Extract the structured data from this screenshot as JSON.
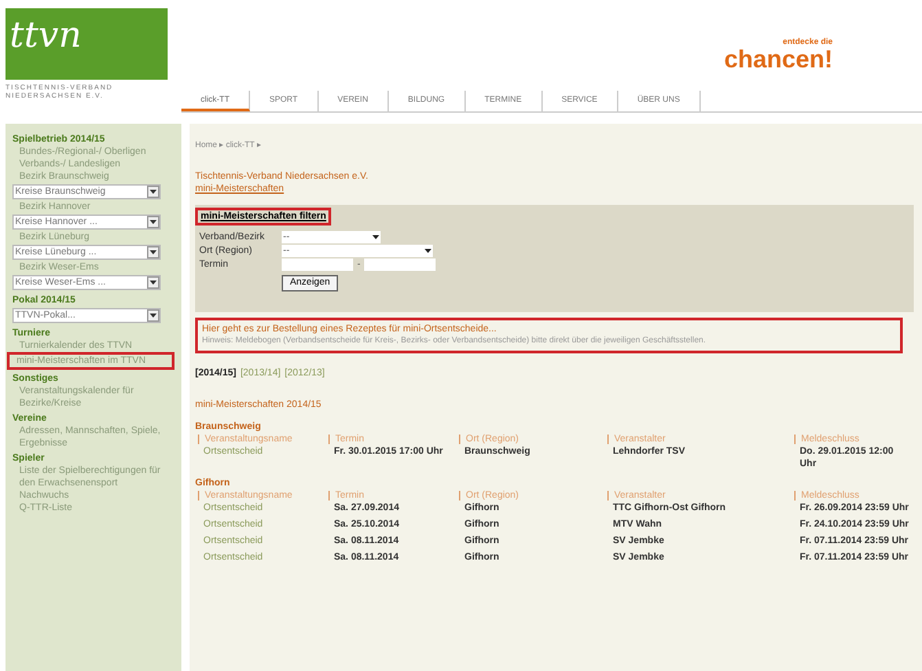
{
  "header": {
    "logo_text": "ttvn",
    "association": "TISCHTENNIS-VERBAND NIEDERSACHSEN E.V.",
    "slogan_top": "entdecke die",
    "slogan": "chancen!"
  },
  "tabs": [
    {
      "label": "click-TT",
      "selected": true
    },
    {
      "label": "SPORT",
      "selected": false
    },
    {
      "label": "VEREIN",
      "selected": false
    },
    {
      "label": "BILDUNG",
      "selected": false
    },
    {
      "label": "TERMINE",
      "selected": false
    },
    {
      "label": "SERVICE",
      "selected": false
    },
    {
      "label": "ÜBER UNS",
      "selected": false
    }
  ],
  "sidebar": [
    {
      "kind": "heading",
      "text": "Spielbetrieb 2014/15"
    },
    {
      "kind": "link",
      "text": "Bundes-/Regional-/ Oberligen",
      "highlighted": false
    },
    {
      "kind": "link",
      "text": "Verbands-/ Landesligen",
      "highlighted": false
    },
    {
      "kind": "link",
      "text": "Bezirk Braunschweig",
      "highlighted": false
    },
    {
      "kind": "select",
      "text": "Kreise Braunschweig"
    },
    {
      "kind": "link",
      "text": "Bezirk Hannover",
      "highlighted": false
    },
    {
      "kind": "select",
      "text": "Kreise Hannover ..."
    },
    {
      "kind": "link",
      "text": "Bezirk Lüneburg",
      "highlighted": false
    },
    {
      "kind": "select",
      "text": "Kreise Lüneburg ..."
    },
    {
      "kind": "link",
      "text": "Bezirk Weser-Ems",
      "highlighted": false
    },
    {
      "kind": "select",
      "text": "Kreise Weser-Ems ..."
    },
    {
      "kind": "heading",
      "text": "Pokal 2014/15"
    },
    {
      "kind": "select",
      "text": "TTVN-Pokal..."
    },
    {
      "kind": "heading",
      "text": "Turniere"
    },
    {
      "kind": "link",
      "text": "Turnierkalender des TTVN",
      "highlighted": false
    },
    {
      "kind": "link",
      "text": "mini-Meisterschaften im TTVN",
      "highlighted": true
    },
    {
      "kind": "heading",
      "text": "Sonstiges"
    },
    {
      "kind": "link",
      "text": "Veranstaltungskalender für Bezirke/Kreise",
      "highlighted": false
    },
    {
      "kind": "heading",
      "text": "Vereine"
    },
    {
      "kind": "link",
      "text": "Adressen, Mannschaften, Spiele, Ergebnisse",
      "highlighted": false
    },
    {
      "kind": "heading",
      "text": "Spieler"
    },
    {
      "kind": "link",
      "text": "Liste der Spielberechtigungen für den Erwachsenensport",
      "highlighted": false
    },
    {
      "kind": "link",
      "text": "Nachwuchs",
      "highlighted": false
    },
    {
      "kind": "link",
      "text": "Q-TTR-Liste",
      "highlighted": false
    }
  ],
  "breadcrumb": "Home ▸ click-TT ▸",
  "org": "Tischtennis-Verband Niedersachsen e.V.",
  "section": "mini-Meisterschaften",
  "filter": {
    "title": "mini-Meisterschaften filtern",
    "highlighted": true,
    "fields": [
      {
        "label": "Verband/Bezirk",
        "kind": "select",
        "value": "--"
      },
      {
        "label": "Ort (Region)",
        "kind": "select-wide",
        "value": "--"
      },
      {
        "label": "Termin",
        "kind": "daterange",
        "separator": "-"
      }
    ],
    "button": "Anzeigen"
  },
  "notice": {
    "highlighted": true,
    "link": "Hier geht es zur Bestellung eines Rezeptes für mini-Ortsentscheide...",
    "hint": "Hinweis: Meldebogen (Verbandsentscheide für Kreis-, Bezirks- oder Verbandsentscheide) bitte direkt über die jeweiligen Geschäftsstellen."
  },
  "seasons": [
    {
      "label": "[2014/15]",
      "selected": true
    },
    {
      "label": "[2013/14]",
      "selected": false
    },
    {
      "label": "[2012/13]",
      "selected": false
    }
  ],
  "list_title": "mini-Meisterschaften 2014/15",
  "groups": [
    {
      "name": "Braunschweig",
      "columns": [
        "Veranstaltungsname",
        "Termin",
        "Ort (Region)",
        "Veranstalter",
        "Meldeschluss"
      ],
      "rows": [
        [
          "Ortsentscheid",
          "Fr. 30.01.2015 17:00 Uhr",
          "Braunschweig",
          "Lehndorfer TSV",
          "Do. 29.01.2015 12:00 Uhr"
        ]
      ]
    },
    {
      "name": "Gifhorn",
      "columns": [
        "Veranstaltungsname",
        "Termin",
        "Ort (Region)",
        "Veranstalter",
        "Meldeschluss"
      ],
      "rows": [
        [
          "Ortsentscheid",
          "Sa. 27.09.2014",
          "Gifhorn",
          "TTC Gifhorn-Ost Gifhorn",
          "Fr. 26.09.2014 23:59 Uhr"
        ],
        [
          "Ortsentscheid",
          "Sa. 25.10.2014",
          "Gifhorn",
          "MTV Wahn",
          "Fr. 24.10.2014 23:59 Uhr"
        ],
        [
          "Ortsentscheid",
          "Sa. 08.11.2014",
          "Gifhorn",
          "SV Jembke",
          "Fr. 07.11.2014 23:59 Uhr"
        ],
        [
          "Ortsentscheid",
          "Sa. 08.11.2014",
          "Gifhorn",
          "SV Jembke",
          "Fr. 07.11.2014 23:59 Uhr"
        ]
      ]
    }
  ]
}
